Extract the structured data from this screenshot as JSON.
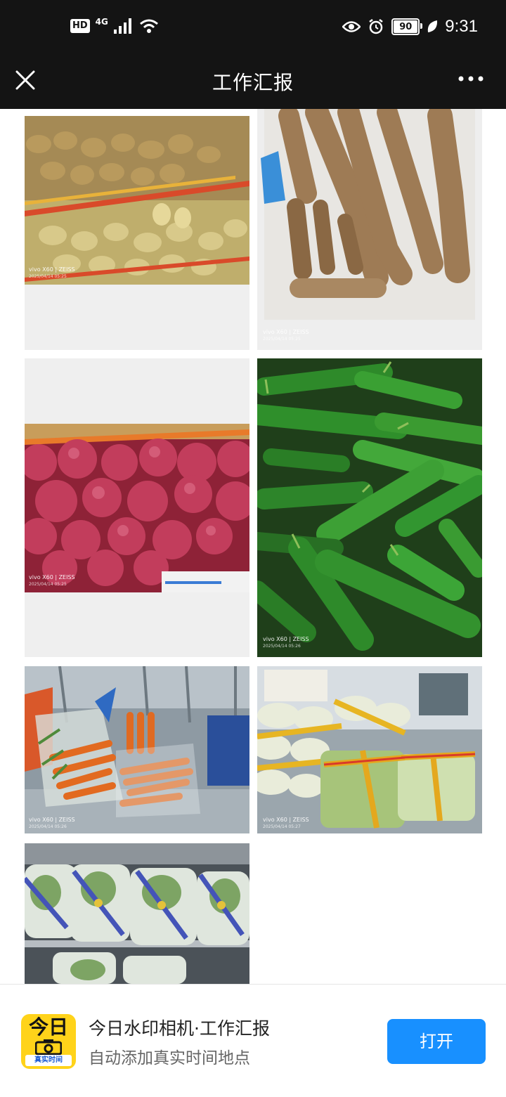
{
  "status_bar": {
    "hd": "HD",
    "network": "4G",
    "battery": "90",
    "time": "9:31",
    "icons": [
      "signal-icon",
      "wifi-icon",
      "eye-icon",
      "alarm-icon",
      "battery-icon",
      "leaf-icon"
    ]
  },
  "nav": {
    "title": "工作汇报",
    "icons": [
      "close-icon",
      "more-icon"
    ]
  },
  "photos": [
    {
      "subject": "potatoes",
      "camera": "vivo X60 | ZEISS",
      "stamp": "2025/04/14 05:25"
    },
    {
      "subject": "yams",
      "camera": "vivo X60 | ZEISS",
      "stamp": "2025/04/14 05:25"
    },
    {
      "subject": "onions",
      "camera": "vivo X60 | ZEISS",
      "stamp": "2025/04/14 05:25"
    },
    {
      "subject": "green-peppers",
      "camera": "vivo X60 | ZEISS",
      "stamp": "2025/04/14 05:26"
    },
    {
      "subject": "carrots",
      "camera": "vivo X60 | ZEISS",
      "stamp": "2025/04/14 05:26"
    },
    {
      "subject": "napa-cabbage",
      "camera": "vivo X60 | ZEISS",
      "stamp": "2025/04/14 05:27"
    },
    {
      "subject": "bok-choy",
      "camera": "",
      "stamp": ""
    }
  ],
  "banner": {
    "logo_top": "今日",
    "logo_bottom": "真实时间",
    "title": "今日水印相机·工作汇报",
    "subtitle": "自动添加真实时间地点",
    "open_label": "打开"
  },
  "colors": {
    "status_bg": "#141414",
    "accent": "#1890ff",
    "logo_yellow": "#ffd31a"
  }
}
